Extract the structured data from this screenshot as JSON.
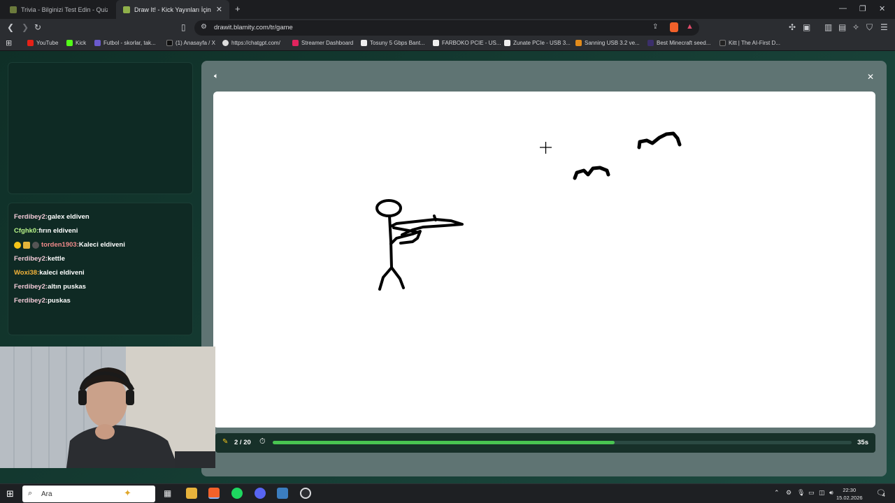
{
  "browser": {
    "tabs": [
      {
        "title": "Trivia - Bilginizi Test Edin - Quizer",
        "active": false
      },
      {
        "title": "Draw It! - Kick Yayınları İçin Çizim",
        "active": true
      }
    ],
    "url": "drawit.blamity.com/tr/game",
    "bookmarks": [
      "YouTube",
      "Kick",
      "Futbol - skorlar, tak...",
      "(1) Anasayfa / X",
      "https://chatgpt.com/",
      "Streamer Dashboard",
      "Tosuny 5 Gbps Bant...",
      "FARBOKO PCIE - US...",
      "Zunate PCIe - USB 3...",
      "Sanning USB 3.2 ve...",
      "Best Minecraft seed...",
      "Kitt | The AI-First D..."
    ]
  },
  "chat": {
    "messages": [
      {
        "user": "Ferdibey2",
        "text": "galex eldiven",
        "color": "#f1c9d6"
      },
      {
        "user": "Cfghk0",
        "text": "fırın eldiveni",
        "color": "#b9f58a"
      },
      {
        "user": "torden1903",
        "text": "Kaleci eldiveni",
        "color": "#f08a8a",
        "badges": true
      },
      {
        "user": "Ferdibey2",
        "text": "kettle",
        "color": "#f1c9d6"
      },
      {
        "user": "Woxi38",
        "text": "kaleci eldiveni",
        "color": "#f5b43a"
      },
      {
        "user": "Ferdibey2",
        "text": "altın puskas",
        "color": "#f1c9d6"
      },
      {
        "user": "Ferdibey2",
        "text": "puskas",
        "color": "#f1c9d6"
      }
    ]
  },
  "game": {
    "round": "2 / 20",
    "timer": "35s",
    "progress": 0.59
  },
  "taskbar": {
    "search_placeholder": "Ara",
    "time": "22:30",
    "date": "15.02.2026",
    "notifications": "4"
  },
  "colors": {
    "accent_green": "#49c451",
    "panel": "#5f7473"
  }
}
